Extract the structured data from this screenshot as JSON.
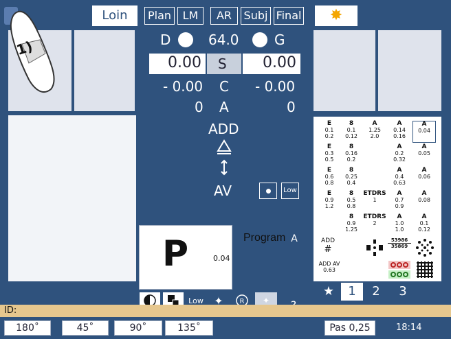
{
  "top": {
    "distance_label": "Loin",
    "mode_buttons": [
      "Plan",
      "LM",
      "AR",
      "Subj",
      "Final"
    ],
    "illumination_icon": "sun-icon"
  },
  "badge_text": "1)",
  "refraction": {
    "right_eye": "D",
    "left_eye": "G",
    "pd": "64.0",
    "sphere_label": "S",
    "sphere_right": "0.00",
    "sphere_left": "0.00",
    "cyl_label": "C",
    "cyl_right": "- 0.00",
    "cyl_left": "- 0.00",
    "axis_label": "A",
    "axis_right": "0",
    "axis_left": "0",
    "add_label": "ADD",
    "acuity_label": "AV",
    "low_label": "Low"
  },
  "preview": {
    "letter": "P",
    "value": "0.04",
    "program_label": "Program",
    "program_value": "A"
  },
  "charts": {
    "col1": [
      {
        "h": "E",
        "a": "0.1",
        "b": "0.2"
      },
      {
        "h": "E",
        "a": "0.3",
        "b": "0.5"
      },
      {
        "h": "E",
        "a": "0.6",
        "b": "0.8"
      },
      {
        "h": "E",
        "a": "0.9",
        "b": "1.2"
      }
    ],
    "col2": [
      {
        "h": "8",
        "a": "0.1",
        "b": "0.12"
      },
      {
        "h": "8",
        "a": "0.16",
        "b": "0.2"
      },
      {
        "h": "8",
        "a": "0.25",
        "b": "0.4"
      },
      {
        "h": "8",
        "a": "0.5",
        "b": "0.8"
      },
      {
        "h": "8",
        "a": "0.9",
        "b": "1.25"
      }
    ],
    "col3": [
      {
        "h": "A",
        "a": "1.25",
        "b": "2.0"
      },
      {
        "h": "ETDRS",
        "a": "1",
        "b": ""
      },
      {
        "h": "ETDRS",
        "a": "2",
        "b": ""
      }
    ],
    "col4": [
      {
        "h": "A",
        "a": "0.14",
        "b": "0.16"
      },
      {
        "h": "A",
        "a": "0.2",
        "b": "0.32"
      },
      {
        "h": "A",
        "a": "0.4",
        "b": "0.63"
      },
      {
        "h": "A",
        "a": "0.7",
        "b": "0.9"
      },
      {
        "h": "A",
        "a": "1.0",
        "b": "1.0"
      }
    ],
    "col5": [
      {
        "h": "A",
        "a": "0.04",
        "b": ""
      },
      {
        "h": "A",
        "a": "0.05",
        "b": ""
      },
      {
        "h": "A",
        "a": "0.06",
        "b": ""
      },
      {
        "h": "A",
        "a": "0.08",
        "b": ""
      },
      {
        "h": "A",
        "a": "0.1",
        "b": "0.12"
      }
    ],
    "add_label": "ADD",
    "add_av_label": "ADD AV",
    "add_av_value": "0.63",
    "stereo_top": "53986",
    "stereo_bottom": "35869",
    "tabs": [
      "★",
      "1",
      "2",
      "3"
    ]
  },
  "tools": {
    "low_label": "Low",
    "help_label": "?"
  },
  "status": {
    "id_label": "ID:"
  },
  "bottom": {
    "axes": [
      "180˚",
      "45˚",
      "90˚",
      "135˚"
    ],
    "step": "Pas 0,25",
    "time": "18:14"
  }
}
